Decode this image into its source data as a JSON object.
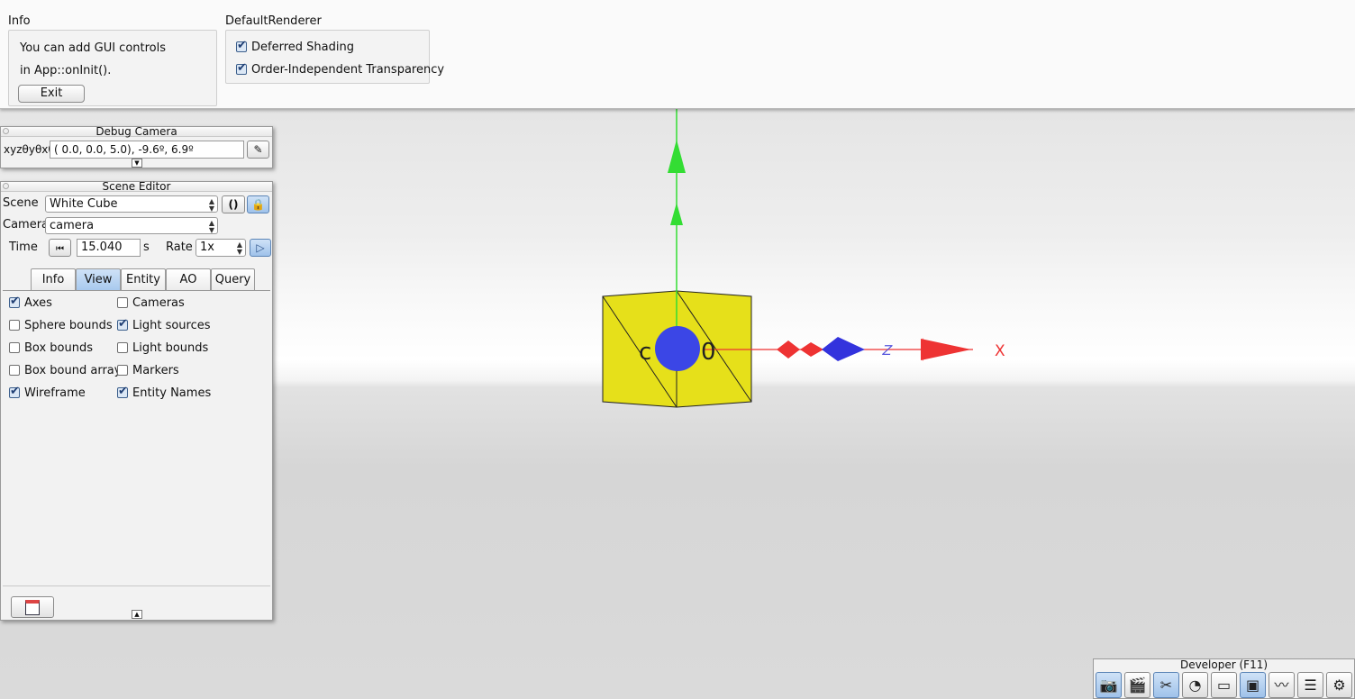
{
  "info_panel": {
    "title": "Info",
    "line1": "You can add GUI controls",
    "line2": "in App::onInit().",
    "exit_label": "Exit"
  },
  "renderer_panel": {
    "title": "DefaultRenderer",
    "options": [
      {
        "label": "Deferred Shading",
        "checked": true
      },
      {
        "label": "Order-Independent Transparency",
        "checked": true
      }
    ]
  },
  "debug_camera": {
    "title": "Debug Camera",
    "coord_label": "xyzθyθxθz",
    "coord_value": "(  0.0,    0.0,    5.0),  -9.6º,   6.9º"
  },
  "scene_editor": {
    "title": "Scene Editor",
    "scene_label": "Scene",
    "scene_value": "White Cube",
    "camera_label": "Camera",
    "camera_value": "camera",
    "time_label": "Time",
    "time_value": "15.040",
    "time_unit": "s",
    "rate_label": "Rate",
    "rate_value": "1x",
    "tabs": [
      "Info",
      "View",
      "Entity",
      "AO",
      "Query"
    ],
    "active_tab": "View",
    "view_options_left": [
      {
        "label": "Axes",
        "checked": true
      },
      {
        "label": "Sphere bounds",
        "checked": false
      },
      {
        "label": "Box bounds",
        "checked": false
      },
      {
        "label": "Box bound array",
        "checked": false
      },
      {
        "label": "Wireframe",
        "checked": true
      }
    ],
    "view_options_right": [
      {
        "label": "Cameras",
        "checked": false
      },
      {
        "label": "Light sources",
        "checked": true
      },
      {
        "label": "Light bounds",
        "checked": false
      },
      {
        "label": "Markers",
        "checked": false
      },
      {
        "label": "Entity Names",
        "checked": true
      }
    ]
  },
  "scene": {
    "axis_x_label": "X",
    "axis_z_label": "Z",
    "cube_label_left": "c",
    "cube_label_right": "0",
    "colors": {
      "cube": "#e6e01a",
      "x_axis": "#ee3333",
      "y_axis": "#33dd33",
      "z_axis": "#3333dd",
      "light": "#3b46e6"
    }
  },
  "developer_bar": {
    "title": "Developer (F11)",
    "buttons": [
      {
        "icon": "camera-icon",
        "active": true
      },
      {
        "icon": "film-clapper-icon",
        "active": false
      },
      {
        "icon": "tools-icon",
        "active": true
      },
      {
        "icon": "profiler-clock-icon",
        "active": false
      },
      {
        "icon": "console-window-icon",
        "active": false
      },
      {
        "icon": "scene-editor-icon",
        "active": true
      },
      {
        "icon": "performance-graph-icon",
        "active": false
      },
      {
        "icon": "log-document-icon",
        "active": false
      },
      {
        "icon": "settings-gear-icon",
        "active": false
      }
    ]
  }
}
